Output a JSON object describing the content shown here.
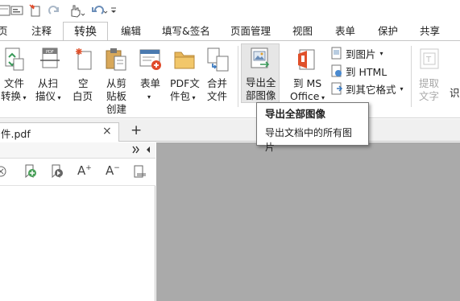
{
  "tabs": [
    "页",
    "注释",
    "转换",
    "编辑",
    "填写&签名",
    "页面管理",
    "视图",
    "表单",
    "保护",
    "共享"
  ],
  "active_tab": "转换",
  "ribbon": {
    "file_convert": {
      "line1": "文件",
      "line2": "转换"
    },
    "from_scanner": {
      "line1": "从扫",
      "line2": "描仪"
    },
    "blank_page": {
      "line1": "空",
      "line2": "白页"
    },
    "from_clipboard": {
      "line1": "从剪",
      "line2": "贴板",
      "line3": "创建"
    },
    "form": {
      "line1": "表单"
    },
    "pdf_package": {
      "line1": "PDF文",
      "line2": "件包"
    },
    "combine": {
      "line1": "合并",
      "line2": "文件"
    },
    "export_images": {
      "line1": "导出全",
      "line2": "部图像"
    },
    "to_office": {
      "line1": "到 MS",
      "line2": "Office"
    },
    "to_image": "到图片",
    "to_html": "到 HTML",
    "to_other": "到其它格式",
    "extract_text": {
      "line1": "提取",
      "line2": "文字"
    },
    "ocr_partial": "识"
  },
  "tooltip": {
    "title": "导出全部图像",
    "body": "导出文档中的所有图片"
  },
  "document_tab": {
    "label": "件.pdf",
    "close": "×",
    "new_tab": "+"
  },
  "colors": {
    "accent_purple": "#e8def4",
    "viewer_bg": "#aaaaaa"
  }
}
